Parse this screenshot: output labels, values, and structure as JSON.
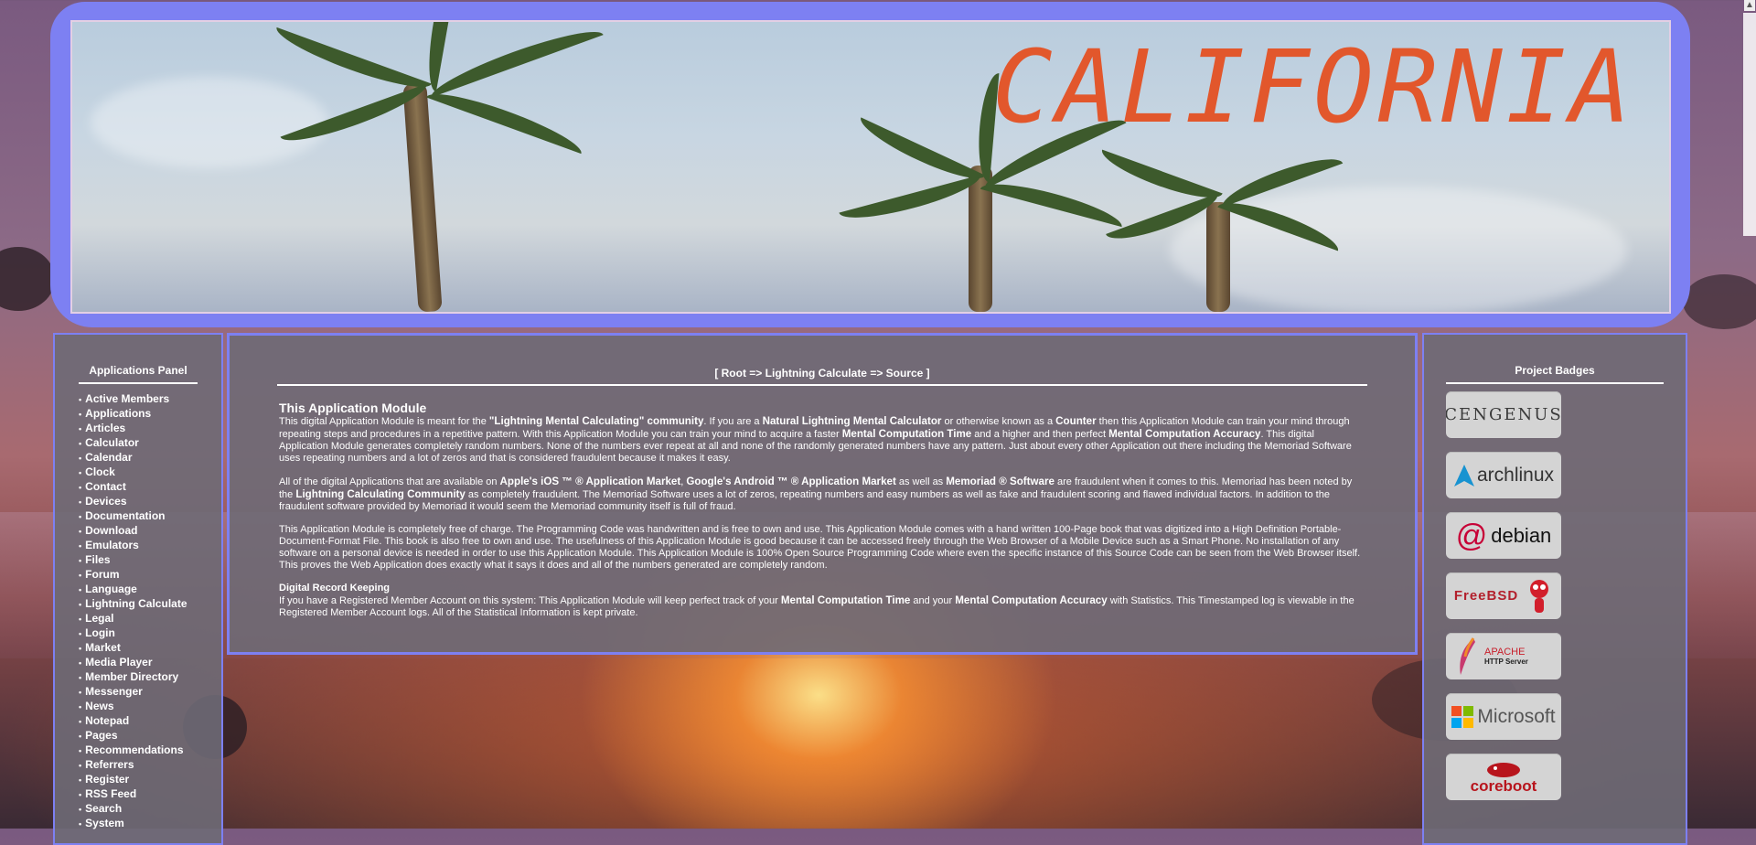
{
  "header": {
    "banner_title": "CALIFORNIA"
  },
  "sidebar": {
    "title": "Applications Panel",
    "items": [
      {
        "label": "Active Members"
      },
      {
        "label": "Applications"
      },
      {
        "label": "Articles"
      },
      {
        "label": "Calculator"
      },
      {
        "label": "Calendar"
      },
      {
        "label": "Clock"
      },
      {
        "label": "Contact"
      },
      {
        "label": "Devices"
      },
      {
        "label": "Documentation"
      },
      {
        "label": "Download"
      },
      {
        "label": "Emulators"
      },
      {
        "label": "Files"
      },
      {
        "label": "Forum"
      },
      {
        "label": "Language"
      },
      {
        "label": "Lightning Calculate"
      },
      {
        "label": "Legal"
      },
      {
        "label": "Login"
      },
      {
        "label": "Market"
      },
      {
        "label": "Media Player"
      },
      {
        "label": "Member Directory"
      },
      {
        "label": "Messenger"
      },
      {
        "label": "News"
      },
      {
        "label": "Notepad"
      },
      {
        "label": "Pages"
      },
      {
        "label": "Recommendations"
      },
      {
        "label": "Referrers"
      },
      {
        "label": "Register"
      },
      {
        "label": "RSS Feed"
      },
      {
        "label": "Search"
      },
      {
        "label": "System"
      }
    ]
  },
  "main": {
    "breadcrumb": "[ Root => Lightning Calculate => Source ]",
    "heading": "This Application Module",
    "p1": {
      "a": "This digital Application Module is meant for the ",
      "b": "\"Lightning Mental Calculating\" community",
      "c": ". If you are a ",
      "d": "Natural Lightning Mental Calculator",
      "e": " or otherwise known as a ",
      "f": "Counter",
      "g": " then this Application Module can train your mind through repeating steps and procedures in a repetitive pattern. With this Application Module you can train your mind to acquire a faster ",
      "h": "Mental Computation Time",
      "i": " and a higher and then perfect ",
      "j": "Mental Computation Accuracy",
      "k": ". This digital Application Module generates completely random numbers. None of the numbers ever repeat at all and none of the randomly generated numbers have any pattern. Just about every other Application out there including the Memoriad Software uses repeating numbers and a lot of zeros and that is considered fraudulent because it makes it easy."
    },
    "p2": {
      "a": "All of the digital Applications that are available on ",
      "b": "Apple's iOS ™ ® Application Market",
      "c": ", ",
      "d": "Google's Android ™ ® Application Market",
      "e": " as well as ",
      "f": "Memoriad ® Software",
      "g": " are fraudulent when it comes to this. Memoriad has been noted by the ",
      "h": "Lightning Calculating Community",
      "i": " as completely fraudulent. The Memoriad Software uses a lot of zeros, repeating numbers and easy numbers as well as fake and fraudulent scoring and flawed individual factors. In addition to the fraudulent software provided by Memoriad it would seem the Memoriad community itself is full of fraud."
    },
    "p3": "This Application Module is completely free of charge. The Programming Code was handwritten and is free to own and use. This Application Module comes with a hand written 100-Page book that was digitized into a High Definition Portable-Document-Format File. This book is also free to own and use. The usefulness of this Application Module is good because it can be accessed freely through the Web Browser of a Mobile Device such as a Smart Phone. No installation of any software on a personal device is needed in order to use this Application Module. This Application Module is 100% Open Source Programming Code where even the specific instance of this Source Code can be seen from the Web Browser itself. This proves the Web Application does exactly what it says it does and all of the numbers generated are completely random.",
    "subheading": "Digital Record Keeping",
    "p4": {
      "a": "If you have a Registered Member Account on this system: This Application Module will keep perfect track of your ",
      "b": "Mental Computation Time",
      "c": " and your ",
      "d": "Mental Computation Accuracy",
      "e": " with Statistics. This Timestamped log is viewable in the Registered Member Account logs. All of the Statistical Information is kept private."
    }
  },
  "badges": {
    "title": "Project Badges",
    "items": [
      {
        "label": "CENGENUS",
        "icon": "cerberus-logo-icon"
      },
      {
        "label": "archlinux",
        "icon": "archlinux-logo-icon"
      },
      {
        "label": "debian",
        "icon": "debian-logo-icon"
      },
      {
        "label": "FreeBSD",
        "icon": "freebsd-logo-icon"
      },
      {
        "label": "APACHE",
        "sub": "HTTP Server",
        "icon": "apache-logo-icon"
      },
      {
        "label": "Microsoft",
        "icon": "microsoft-logo-icon"
      },
      {
        "label": "coreboot",
        "icon": "coreboot-logo-icon"
      }
    ]
  },
  "colors": {
    "frame": "#7d80f2",
    "banner_title": "#e2572c",
    "panel_bg": "#6e6a76"
  }
}
